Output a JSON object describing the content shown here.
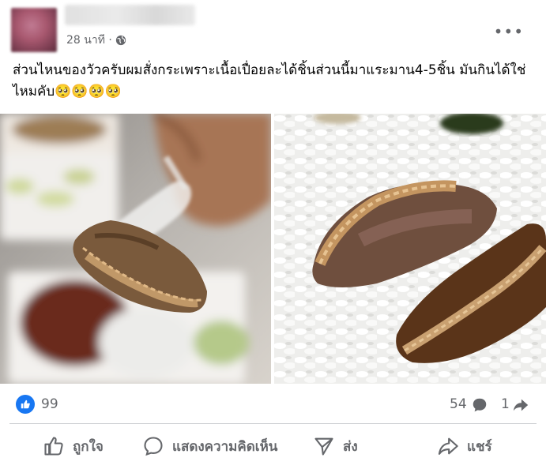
{
  "post": {
    "time": "28 นาที ·",
    "more": "•••",
    "text": "ส่วนไหนของวัวครับผมสั่งกระเพราะเนื้อเปื่อยละได้ชิ้นส่วนนี้มาแระมาน4-5ชิ้น มันกินได้ใช่ไหมคับ🥺🥺🥺🥺"
  },
  "reactions": {
    "like_count": "99",
    "comment_count": "54",
    "share_count": "1"
  },
  "actions": {
    "like": "ถูกใจ",
    "comment": "แสดงความคิดเห็น",
    "send": "ส่ง",
    "share": "แชร์"
  },
  "colors": {
    "accent": "#1877f2",
    "secondary_text": "#65676b",
    "divider": "#ced0d4"
  }
}
